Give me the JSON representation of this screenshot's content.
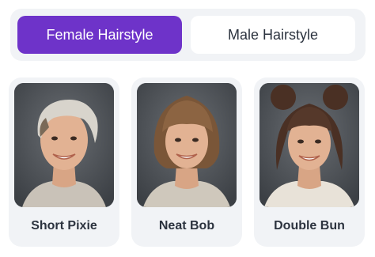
{
  "tabs": {
    "female_label": "Female Hairstyle",
    "male_label": "Male Hairstyle",
    "active": "female"
  },
  "styles": [
    {
      "label": "Short Pixie",
      "icon": "short-pixie-portrait"
    },
    {
      "label": "Neat Bob",
      "icon": "neat-bob-portrait"
    },
    {
      "label": "Double Bun",
      "icon": "double-bun-portrait"
    }
  ],
  "colors": {
    "accent": "#6e33c9",
    "panel_bg": "#f1f3f6",
    "text": "#2c333f"
  }
}
